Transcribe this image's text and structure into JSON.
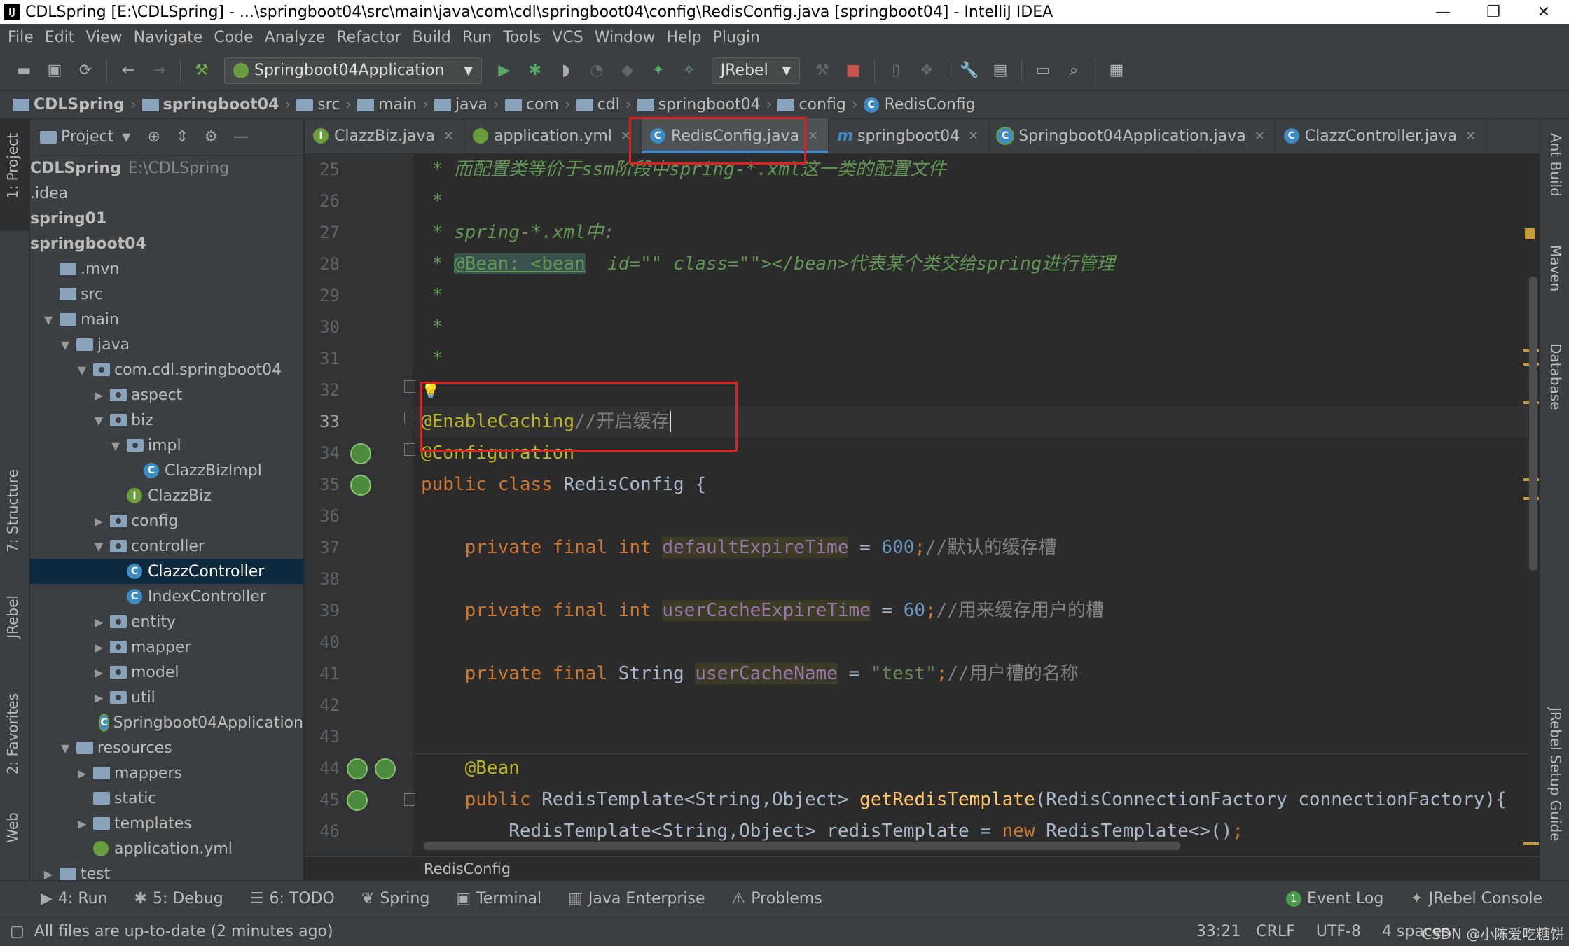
{
  "window": {
    "title": "CDLSpring [E:\\CDLSpring] - ...\\springboot04\\src\\main\\java\\com\\cdl\\springboot04\\config\\RedisConfig.java [springboot04] - IntelliJ IDEA",
    "logo": "IJ",
    "controls": [
      "—",
      "❐",
      "✕"
    ]
  },
  "menu": [
    "File",
    "Edit",
    "View",
    "Navigate",
    "Code",
    "Analyze",
    "Refactor",
    "Build",
    "Run",
    "Tools",
    "VCS",
    "Window",
    "Help",
    "Plugin"
  ],
  "toolbar": {
    "run_config": "Springboot04Application",
    "jrebel": "JRebel",
    "dropdown_glyph": "▼"
  },
  "breadcrumb": [
    "CDLSpring",
    "springboot04",
    "src",
    "main",
    "java",
    "com",
    "cdl",
    "springboot04",
    "config",
    "RedisConfig"
  ],
  "project": {
    "title": "Project",
    "tree": [
      {
        "label": "CDLSpring",
        "extra": "E:\\CDLSpring",
        "level": 0,
        "bold": true
      },
      {
        "label": ".idea",
        "level": 0
      },
      {
        "label": "spring01",
        "level": 0,
        "bold": true
      },
      {
        "label": "springboot04",
        "level": 0,
        "bold": true
      },
      {
        "label": ".mvn",
        "level": 1
      },
      {
        "label": "src",
        "level": 1
      },
      {
        "label": "main",
        "level": 1,
        "arrow": "▼"
      },
      {
        "label": "java",
        "level": 2,
        "arrow": "▼"
      },
      {
        "label": "com.cdl.springboot04",
        "level": 3,
        "arrow": "▼"
      },
      {
        "label": "aspect",
        "level": 4,
        "arrow": "▶"
      },
      {
        "label": "biz",
        "level": 4,
        "arrow": "▼"
      },
      {
        "label": "impl",
        "level": 5,
        "arrow": "▼"
      },
      {
        "label": "ClazzBizImpl",
        "level": 6,
        "icon": "C"
      },
      {
        "label": "ClazzBiz",
        "level": 5,
        "icon": "I"
      },
      {
        "label": "config",
        "level": 4,
        "arrow": "▶"
      },
      {
        "label": "controller",
        "level": 4,
        "arrow": "▼"
      },
      {
        "label": "ClazzController",
        "level": 5,
        "icon": "C",
        "selected": true
      },
      {
        "label": "IndexController",
        "level": 5,
        "icon": "C"
      },
      {
        "label": "entity",
        "level": 4,
        "arrow": "▶"
      },
      {
        "label": "mapper",
        "level": 4,
        "arrow": "▶"
      },
      {
        "label": "model",
        "level": 4,
        "arrow": "▶"
      },
      {
        "label": "util",
        "level": 4,
        "arrow": "▶"
      },
      {
        "label": "Springboot04Application",
        "level": 4,
        "icon": "S"
      },
      {
        "label": "resources",
        "level": 2,
        "arrow": "▼"
      },
      {
        "label": "mappers",
        "level": 3,
        "arrow": "▶"
      },
      {
        "label": "static",
        "level": 3
      },
      {
        "label": "templates",
        "level": 3,
        "arrow": "▶"
      },
      {
        "label": "application.yml",
        "level": 3,
        "icon": "Y"
      },
      {
        "label": "test",
        "level": 1,
        "arrow": "▶"
      }
    ]
  },
  "tabs": [
    {
      "label": "ClazzBiz.java",
      "icon": "I"
    },
    {
      "label": "application.yml",
      "icon": "Y"
    },
    {
      "label": "RedisConfig.java",
      "icon": "C",
      "active": true
    },
    {
      "label": "springboot04",
      "icon": "m"
    },
    {
      "label": "Springboot04Application.java",
      "icon": "S"
    },
    {
      "label": "ClazzController.java",
      "icon": "C"
    }
  ],
  "editor": {
    "line_numbers": [
      "25",
      "26",
      "27",
      "28",
      "29",
      "30",
      "31",
      "32",
      "33",
      "34",
      "35",
      "36",
      "37",
      "38",
      "39",
      "40",
      "41",
      "42",
      "43",
      "44",
      "45",
      "46"
    ],
    "current_line": "33",
    "footer": "RedisConfig",
    "code": {
      "l25": " * 而配置类等价于ssm阶段中spring-*.xml这一类的配置文件",
      "l26": " *",
      "l27": " * spring-*.xml中:",
      "l28a": " * ",
      "l28b": "@Bean: <bean",
      "l28c": "  id=\"\" class=\"\"></bean>代表某个类交给spring进行管理",
      "l29": " *",
      "l30": " *",
      "l31": " *",
      "l33a": "@EnableCaching",
      "l33b": "//开启缓存",
      "l34": "@Configuration",
      "l35a": "public class ",
      "l35b": "RedisConfig {",
      "l37a": "    private final int ",
      "l37b": "defaultExpireTime",
      "l37c": " = ",
      "l37d": "600",
      "l37e": ";",
      "l37f": "//默认的缓存槽",
      "l39a": "    private final int ",
      "l39b": "userCacheExpireTime",
      "l39c": " = ",
      "l39d": "60",
      "l39e": ";",
      "l39f": "//用来缓存用户的槽",
      "l41a": "    private final ",
      "l41b": "String ",
      "l41c": "userCacheName",
      "l41d": " = ",
      "l41e": "\"test\"",
      "l41f": ";",
      "l41g": "//用户槽的名称",
      "l43": "    @Bean",
      "l44a": "    public ",
      "l44b": "RedisTemplate<String,Object> ",
      "l44c": "getRedisTemplate",
      "l44d": "(RedisConnectionFactory connectionFactory){",
      "l45a": "        RedisTemplate<String,Object> redisTemplate = ",
      "l45b": "new ",
      "l45c": "RedisTemplate<>()",
      "l45d": ";"
    }
  },
  "left_strip": [
    "1: Project",
    "7: Structure",
    "JRebel",
    "2: Favorites",
    "Web"
  ],
  "right_strip": [
    "Ant Build",
    "Maven",
    "Database",
    "JRebel Setup Guide"
  ],
  "bottom_tools": [
    {
      "label": "4: Run",
      "icon": "▶"
    },
    {
      "label": "5: Debug",
      "icon": "✱"
    },
    {
      "label": "6: TODO",
      "icon": "☰"
    },
    {
      "label": "Spring",
      "icon": "❦"
    },
    {
      "label": "Terminal",
      "icon": "▣"
    },
    {
      "label": "Java Enterprise",
      "icon": "▦"
    },
    {
      "label": "Problems",
      "icon": "⚠"
    }
  ],
  "bottom_right_tools": [
    {
      "label": "Event Log",
      "icon": "1"
    },
    {
      "label": "JRebel Console",
      "icon": "✦"
    }
  ],
  "status": {
    "message": "All files are up-to-date (2 minutes ago)",
    "position": "33:21",
    "line_sep": "CRLF",
    "encoding": "UTF-8",
    "indent": "4 spaces"
  },
  "watermark": "CSDN @小陈爱吃糖饼"
}
